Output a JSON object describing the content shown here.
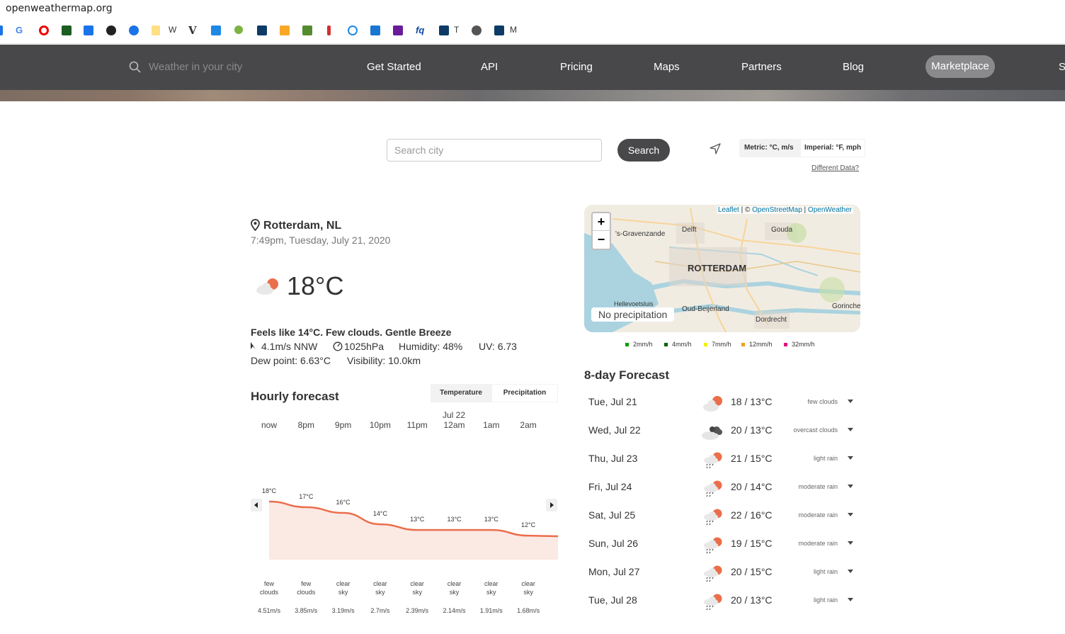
{
  "browser": {
    "url": "openweathermap.org",
    "bookmarks": [
      "W",
      "T",
      "M"
    ]
  },
  "nav": {
    "search_placeholder": "Weather in your city",
    "links": [
      "Get Started",
      "API",
      "Pricing",
      "Maps",
      "Partners",
      "Blog"
    ],
    "marketplace": "Marketplace",
    "partial": "S"
  },
  "search": {
    "placeholder": "Search city",
    "button": "Search",
    "metric": "Metric: °C, m/s",
    "imperial": "Imperial: °F, mph",
    "different_data": "Different Data?"
  },
  "current": {
    "city": "Rotterdam, NL",
    "datetime": "7:49pm, Tuesday, July 21, 2020",
    "temp": "18°C",
    "summary": "Feels like 14°C. Few clouds. Gentle Breeze",
    "wind": "4.1m/s NNW",
    "pressure": "1025hPa",
    "humidity": "Humidity:  48%",
    "uv": "UV:  6.73",
    "dew": "Dew point:  6.63°C",
    "visibility": "Visibility:  10.0km"
  },
  "hourly": {
    "title": "Hourly forecast",
    "tab_temperature": "Temperature",
    "tab_precipitation": "Precipitation",
    "date_label": "Jul 22",
    "hours": [
      "now",
      "8pm",
      "9pm",
      "10pm",
      "11pm",
      "12am",
      "1am",
      "2am"
    ],
    "temps": [
      "18°C",
      "17°C",
      "16°C",
      "14°C",
      "13°C",
      "13°C",
      "13°C",
      "12°C"
    ],
    "desc_line1": [
      "few",
      "few",
      "clear",
      "clear",
      "clear",
      "clear",
      "clear",
      "clear"
    ],
    "desc_line2": [
      "clouds",
      "clouds",
      "sky",
      "sky",
      "sky",
      "sky",
      "sky",
      "sky"
    ],
    "wind": [
      "4.51m/s",
      "3.85m/s",
      "3.19m/s",
      "2.7m/s",
      "2.39m/s",
      "2.14m/s",
      "1.91m/s",
      "1.68m/s"
    ],
    "temp_values": [
      18,
      17,
      16,
      14,
      13,
      13,
      13,
      12
    ]
  },
  "map": {
    "zoom_in": "+",
    "zoom_out": "−",
    "attrib_leaflet": "Leaflet",
    "attrib_mid": " | © ",
    "attrib_osm": "OpenStreetMap",
    "attrib_sep": " | ",
    "attrib_ow": "OpenWeather",
    "labels": [
      "'s-Gravenzande",
      "Delft",
      "Gouda",
      "ROTTERDAM",
      "Hellevoetsluis",
      "Oud-Beijerland",
      "Dordrecht",
      "Gorinche"
    ],
    "no_precipitation": "No precipitation",
    "legend": [
      {
        "label": "2mm/h",
        "color": "#00a000"
      },
      {
        "label": "4mm/h",
        "color": "#006400"
      },
      {
        "label": "7mm/h",
        "color": "#f0f000"
      },
      {
        "label": "12mm/h",
        "color": "#f0a020"
      },
      {
        "label": "32mm/h",
        "color": "#e0147a"
      }
    ]
  },
  "forecast": {
    "title": "8-day Forecast",
    "days": [
      {
        "day": "Tue, Jul 21",
        "temp": "18 / 13°C",
        "desc": "few clouds",
        "icon": "few-clouds"
      },
      {
        "day": "Wed, Jul 22",
        "temp": "20 / 13°C",
        "desc": "overcast clouds",
        "icon": "overcast"
      },
      {
        "day": "Thu, Jul 23",
        "temp": "21 / 15°C",
        "desc": "light rain",
        "icon": "rain"
      },
      {
        "day": "Fri, Jul 24",
        "temp": "20 / 14°C",
        "desc": "moderate rain",
        "icon": "rain"
      },
      {
        "day": "Sat, Jul 25",
        "temp": "22 / 16°C",
        "desc": "moderate rain",
        "icon": "rain"
      },
      {
        "day": "Sun, Jul 26",
        "temp": "19 / 15°C",
        "desc": "moderate rain",
        "icon": "rain"
      },
      {
        "day": "Mon, Jul 27",
        "temp": "20 / 15°C",
        "desc": "light rain",
        "icon": "rain"
      },
      {
        "day": "Tue, Jul 28",
        "temp": "20 / 13°C",
        "desc": "light rain",
        "icon": "rain"
      }
    ]
  },
  "colors": {
    "accent": "#eb6e4b",
    "nav_bg": "#48484a"
  }
}
